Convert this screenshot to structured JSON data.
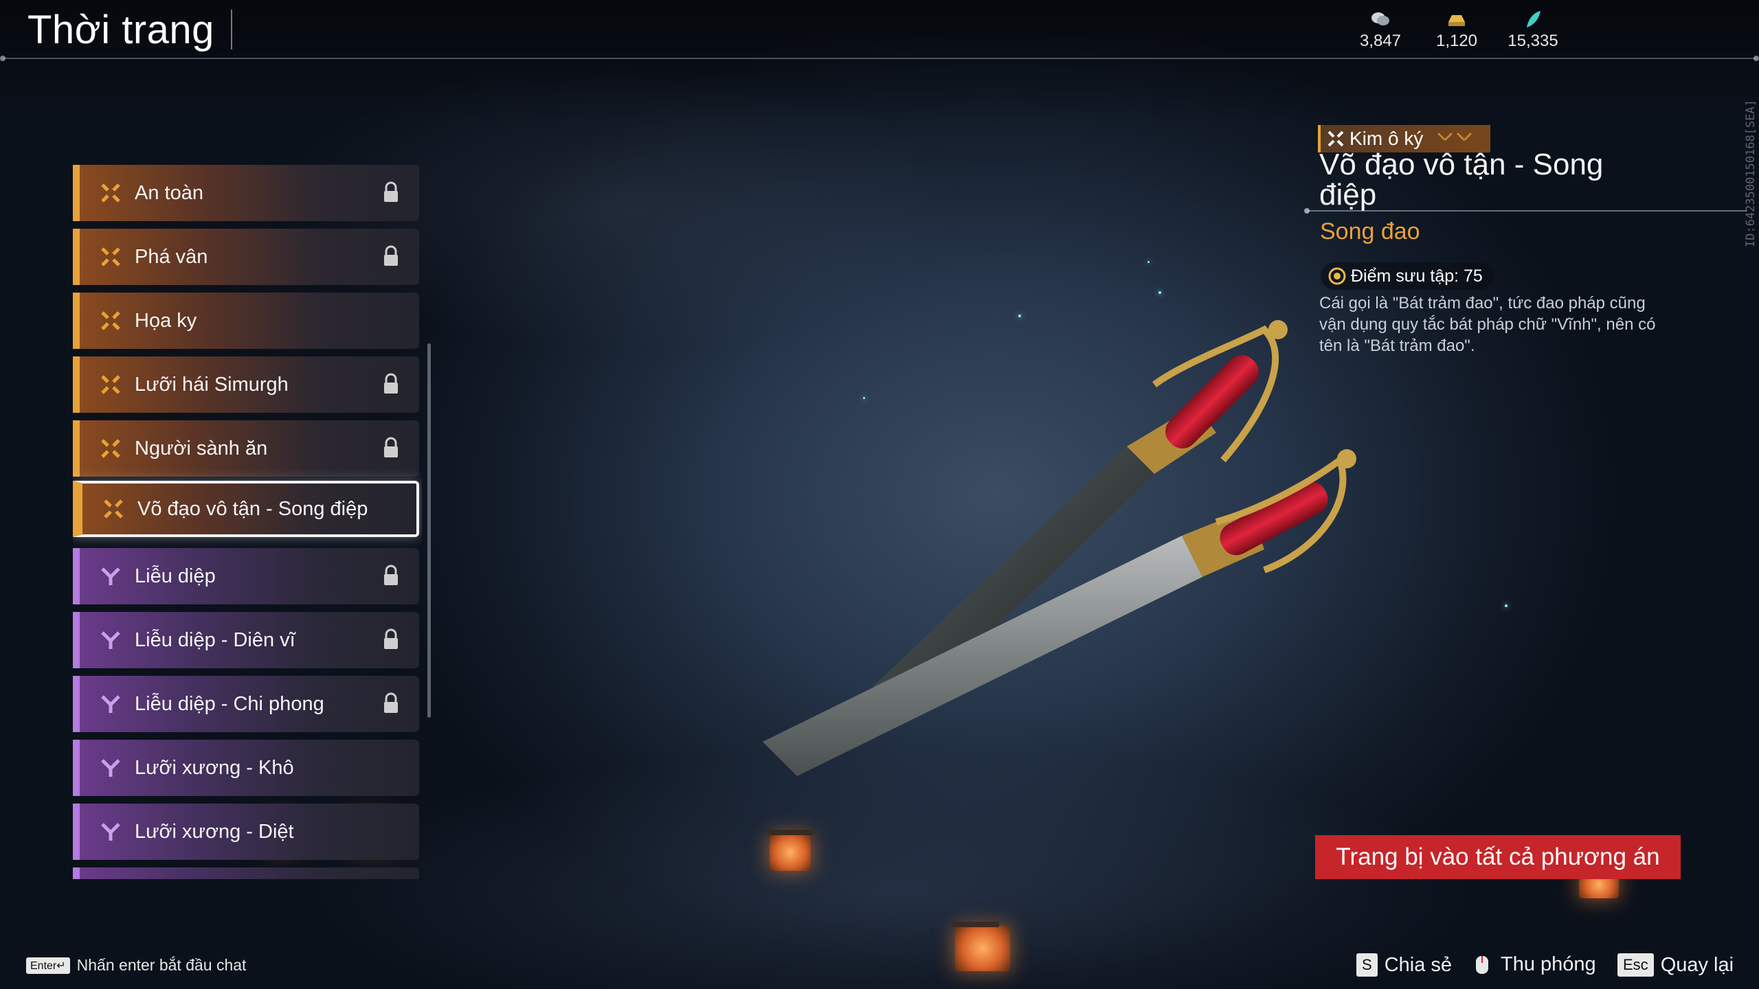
{
  "header": {
    "title": "Thời trang",
    "currencies": [
      {
        "icon": "coin-stack-icon",
        "value": "3,847"
      },
      {
        "icon": "gold-ingot-icon",
        "value": "1,120"
      },
      {
        "icon": "jade-feather-icon",
        "value": "15,335"
      }
    ]
  },
  "side_id": "ID:6423500150168[SEA]",
  "list": {
    "items": [
      {
        "label": "An toàn",
        "rarity": "gold",
        "locked": true
      },
      {
        "label": "Phá vân",
        "rarity": "gold",
        "locked": true
      },
      {
        "label": "Họa ky",
        "rarity": "gold",
        "locked": false
      },
      {
        "label": "Lưỡi hái Simurgh",
        "rarity": "gold",
        "locked": true
      },
      {
        "label": "Người sành ăn",
        "rarity": "gold",
        "locked": true
      },
      {
        "label": "Võ đạo vô tận - Song điệp",
        "rarity": "gold",
        "locked": false,
        "selected": true
      },
      {
        "label": "Liễu diệp",
        "rarity": "purple",
        "locked": true
      },
      {
        "label": "Liễu diệp - Diên vĩ",
        "rarity": "purple",
        "locked": true
      },
      {
        "label": "Liễu diệp - Chi phong",
        "rarity": "purple",
        "locked": true
      },
      {
        "label": "Lưỡi xương - Khô",
        "rarity": "purple",
        "locked": false
      },
      {
        "label": "Lưỡi xương - Diệt",
        "rarity": "purple",
        "locked": false
      }
    ]
  },
  "detail": {
    "rarity_label": "Kim ô ký",
    "title": "Võ đạo vô tận - Song điệp",
    "category": "Song đao",
    "points_label": "Điểm sưu tập: 75",
    "description": "Cái gọi là \"Bát trảm đao\", tức đao pháp cũng vận dụng quy tắc bát pháp chữ \"Vĩnh\", nên có tên là \"Bát trảm đao\".",
    "equip_button": "Trang bị vào tất cả phương án"
  },
  "footer": {
    "chat_key": "Enter↵",
    "chat_hint": "Nhấn enter bắt đầu chat",
    "share_key": "S",
    "share_label": "Chia sẻ",
    "zoom_label": "Thu phóng",
    "back_key": "Esc",
    "back_label": "Quay lại"
  },
  "colors": {
    "gold_accent": "#e8a23a",
    "purple_accent": "#b57be0",
    "equip_button": "#c6252a",
    "category_text": "#e8a23a"
  }
}
